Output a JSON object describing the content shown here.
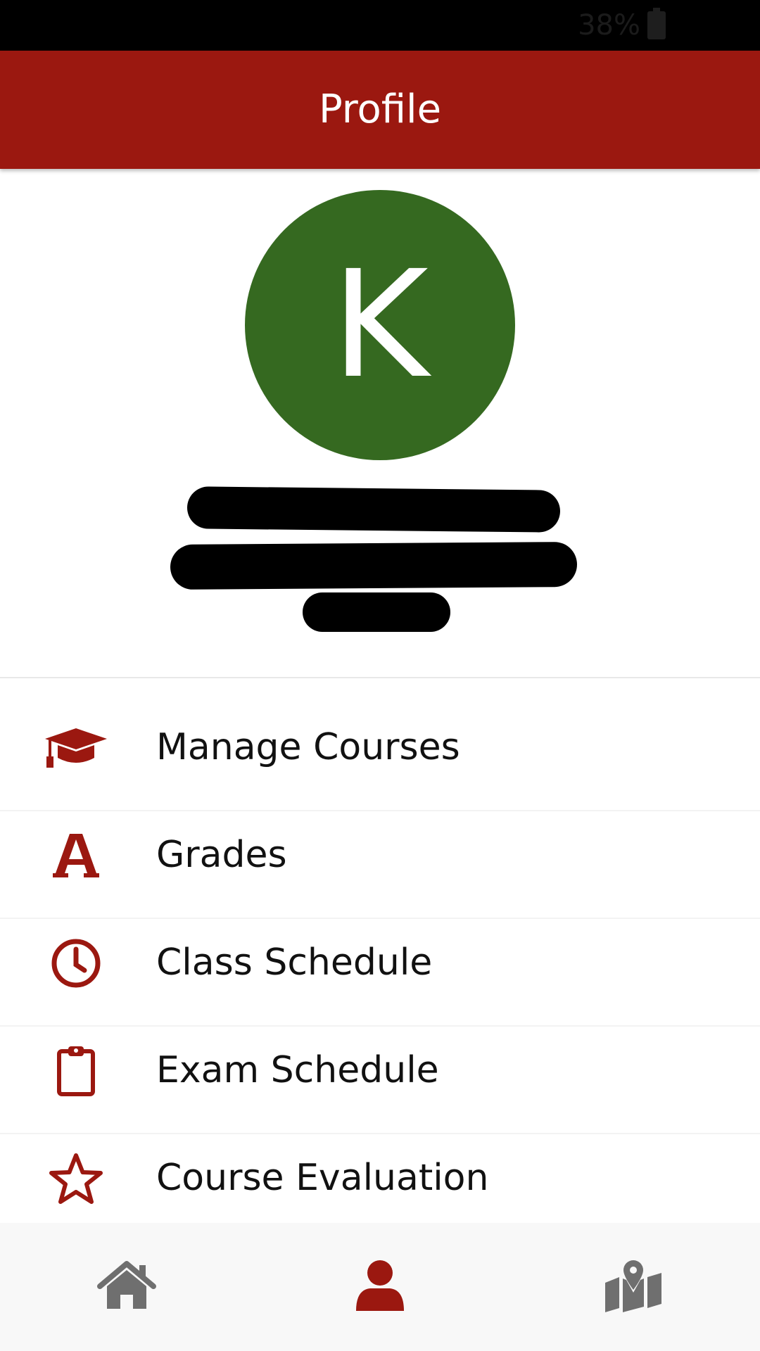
{
  "status_bar": {
    "battery_percent": "38%"
  },
  "header": {
    "title": "Profile"
  },
  "profile": {
    "avatar_letter": "K",
    "avatar_color": "#356920"
  },
  "menu": {
    "items": [
      {
        "label": "Manage Courses",
        "icon": "graduation-cap-icon"
      },
      {
        "label": "Grades",
        "icon": "letter-a-icon"
      },
      {
        "label": "Class Schedule",
        "icon": "clock-icon"
      },
      {
        "label": "Exam Schedule",
        "icon": "clipboard-icon"
      },
      {
        "label": "Course Evaluation",
        "icon": "star-icon"
      }
    ]
  },
  "bottom_nav": {
    "items": [
      {
        "icon": "home-icon",
        "active": false
      },
      {
        "icon": "user-icon",
        "active": true
      },
      {
        "icon": "map-icon",
        "active": false
      }
    ]
  },
  "colors": {
    "accent": "#9b1810",
    "nav_inactive": "#6f6f6f"
  }
}
